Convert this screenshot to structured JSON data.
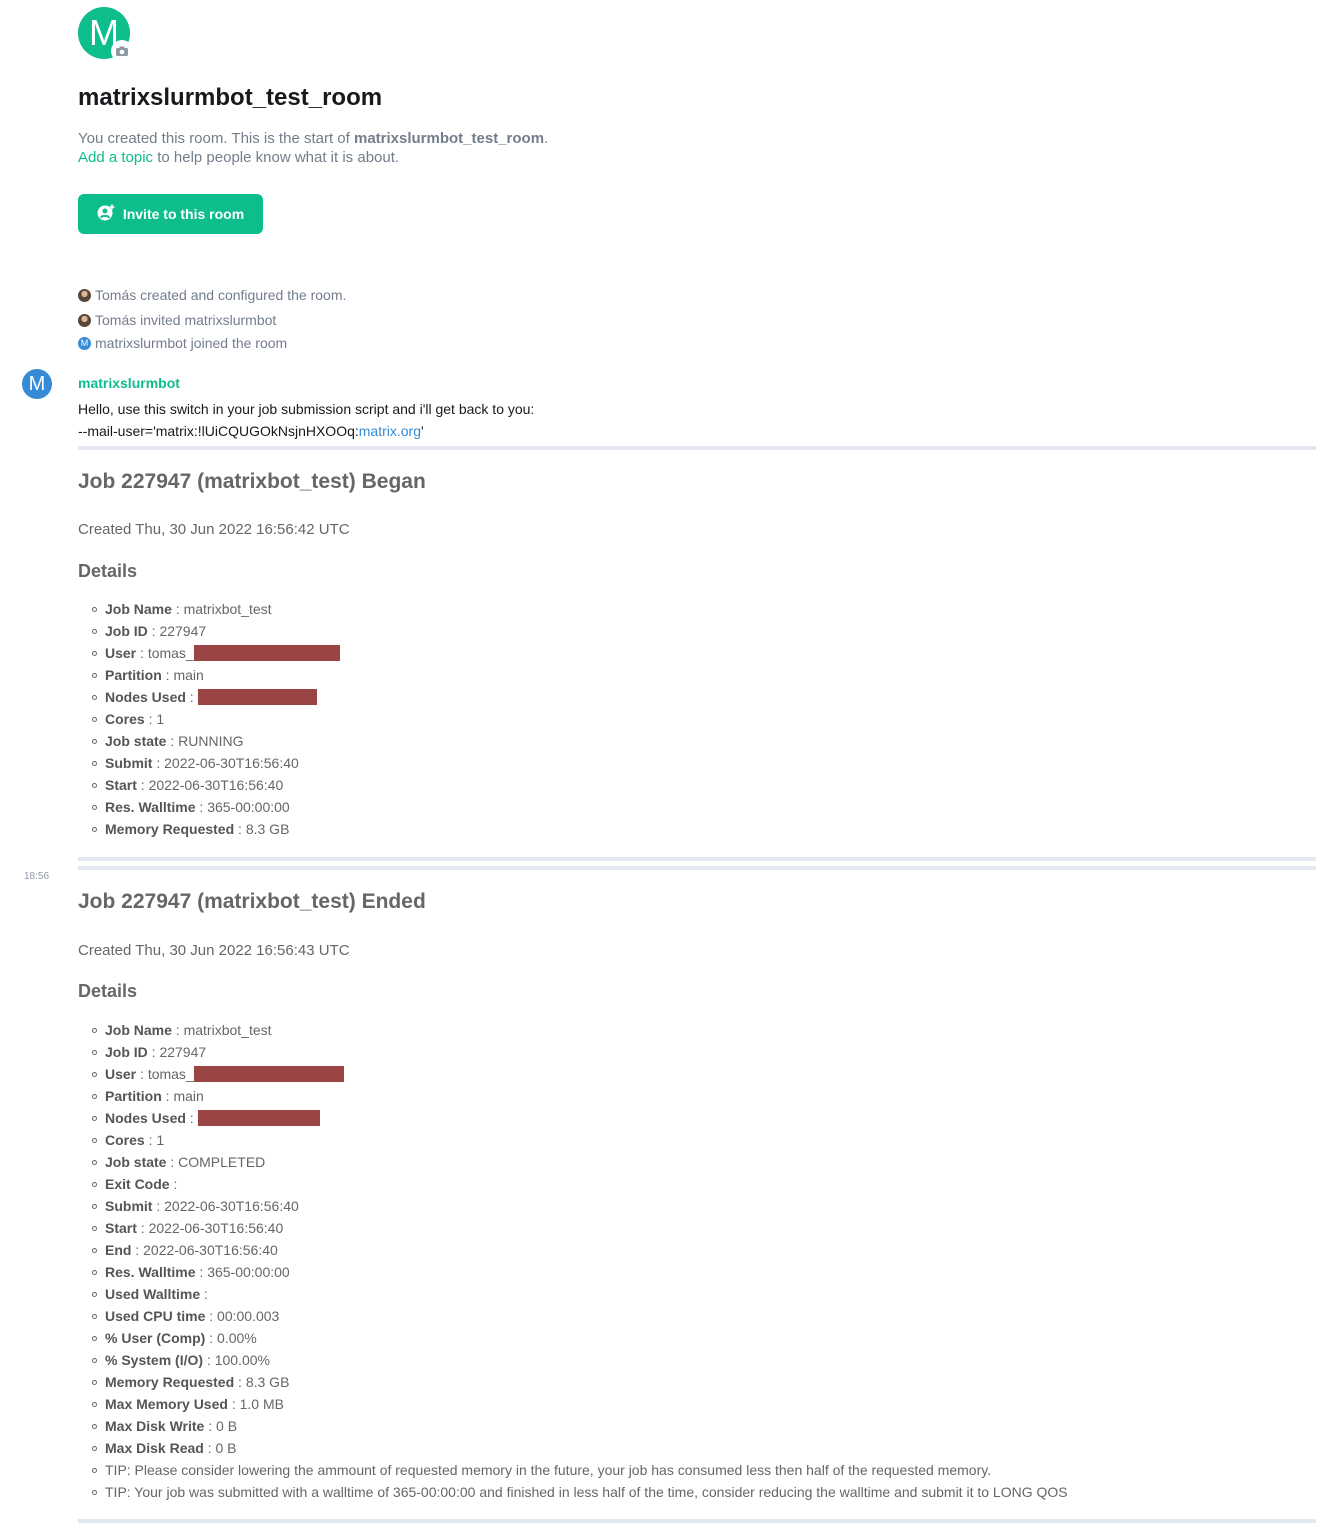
{
  "room": {
    "avatar_letter": "M",
    "name": "matrixslurmbot_test_room",
    "intro_prefix": "You created this room. This is the start of ",
    "intro_room_name": "matrixslurmbot_test_room",
    "intro_period": ".",
    "add_topic_link": "Add a topic",
    "add_topic_suffix": " to help people know what it is about.",
    "invite_label": "Invite to this room"
  },
  "events": [
    {
      "avatar": "photo",
      "text": "Tomás created and configured the room."
    },
    {
      "avatar": "photo",
      "text": "Tomás invited matrixslurmbot"
    },
    {
      "avatar": "M",
      "text": "matrixslurmbot joined the room"
    }
  ],
  "message": {
    "sender_avatar_letter": "M",
    "sender": "matrixslurmbot",
    "line1": "Hello, use this switch in your job submission script and i'll get back to you:",
    "line2_prefix": "--mail-user='matrix:!lUiCQUGOkNsjnHXOOq:",
    "line2_link": "matrix.org",
    "line2_suffix": "'"
  },
  "timestamp": "18:56",
  "redaction_color": "#9b4444",
  "accent_color": "#0dbd8b",
  "jobs": [
    {
      "title": "Job 227947 (matrixbot_test) Began",
      "created": "Created Thu, 30 Jun 2022 16:56:42 UTC",
      "details_heading": "Details",
      "details": [
        {
          "key": "Job Name",
          "value": "matrixbot_test"
        },
        {
          "key": "Job ID",
          "value": "227947"
        },
        {
          "key": "User",
          "value": "tomas_",
          "redacted": true
        },
        {
          "key": "Partition",
          "value": "main"
        },
        {
          "key": "Nodes Used",
          "value": "",
          "redacted": true
        },
        {
          "key": "Cores",
          "value": "1"
        },
        {
          "key": "Job state",
          "value": "RUNNING"
        },
        {
          "key": "Submit",
          "value": "2022-06-30T16:56:40"
        },
        {
          "key": "Start",
          "value": "2022-06-30T16:56:40"
        },
        {
          "key": "Res. Walltime",
          "value": "365-00:00:00"
        },
        {
          "key": "Memory Requested",
          "value": "8.3 GB"
        }
      ]
    },
    {
      "title": "Job 227947 (matrixbot_test) Ended",
      "created": "Created Thu, 30 Jun 2022 16:56:43 UTC",
      "details_heading": "Details",
      "details": [
        {
          "key": "Job Name",
          "value": "matrixbot_test"
        },
        {
          "key": "Job ID",
          "value": "227947"
        },
        {
          "key": "User",
          "value": "tomas_",
          "redacted": true
        },
        {
          "key": "Partition",
          "value": "main"
        },
        {
          "key": "Nodes Used",
          "value": "",
          "redacted": true
        },
        {
          "key": "Cores",
          "value": "1"
        },
        {
          "key": "Job state",
          "value": "COMPLETED"
        },
        {
          "key": "Exit Code",
          "value": ""
        },
        {
          "key": "Submit",
          "value": "2022-06-30T16:56:40"
        },
        {
          "key": "Start",
          "value": "2022-06-30T16:56:40"
        },
        {
          "key": "End",
          "value": "2022-06-30T16:56:40"
        },
        {
          "key": "Res. Walltime",
          "value": "365-00:00:00"
        },
        {
          "key": "Used Walltime",
          "value": ""
        },
        {
          "key": "Used CPU time",
          "value": "00:00.003"
        },
        {
          "key": "% User (Comp)",
          "value": "0.00%"
        },
        {
          "key": "% System (I/O)",
          "value": "100.00%"
        },
        {
          "key": "Memory Requested",
          "value": "8.3 GB"
        },
        {
          "key": "Max Memory Used",
          "value": "1.0 MB"
        },
        {
          "key": "Max Disk Write",
          "value": "0 B"
        },
        {
          "key": "Max Disk Read",
          "value": "0 B"
        }
      ],
      "tips": [
        "TIP: Please consider lowering the ammount of requested memory in the future, your job has consumed less then half of the requested memory.",
        "TIP: Your job was submitted with a walltime of 365-00:00:00 and finished in less half of the time, consider reducing the walltime and submit it to LONG QOS"
      ]
    }
  ]
}
